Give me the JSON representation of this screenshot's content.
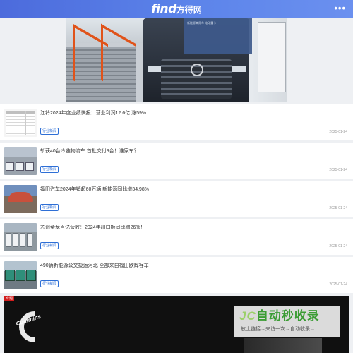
{
  "header": {
    "logo_en": "find",
    "logo_cn": "方得网",
    "more_label": "•••"
  },
  "hero": {
    "screen_text": "新能源商用车 电动重卡"
  },
  "news": [
    {
      "title": "江铃2024年度业绩快报：营业利润12.6亿 涨59%",
      "tag": "行业新闻",
      "date": "2025-01-24"
    },
    {
      "title": "斩获40台冷链物流车 首批交付9台！谁家车？",
      "tag": "行业新闻",
      "date": "2025-01-24"
    },
    {
      "title": "福田汽车2024年销超60万辆 新能源同比增34.98%",
      "tag": "行业新闻",
      "date": "2025-01-24"
    },
    {
      "title": "苏州金龙百亿营收：2024年出口额同比增26%！",
      "tag": "行业新闻",
      "date": "2025-01-24"
    },
    {
      "title": "490辆新能源公交投运河北 全部来自福田欧辉客车",
      "tag": "行业新闻",
      "date": "2025-01-24"
    }
  ],
  "ad": {
    "label": "专题",
    "brand_text": "Cummins"
  },
  "watermark": {
    "main_icon": "JC",
    "main_text": "自动秒收录",
    "sub_text": "放上链接→来访一次→自动收录→"
  },
  "colors": {
    "header_blue": "#4c6bdc",
    "tag_blue": "#2e6fd6",
    "ad_label_red": "#d21d1d",
    "watermark_green": "#3b9c34"
  }
}
